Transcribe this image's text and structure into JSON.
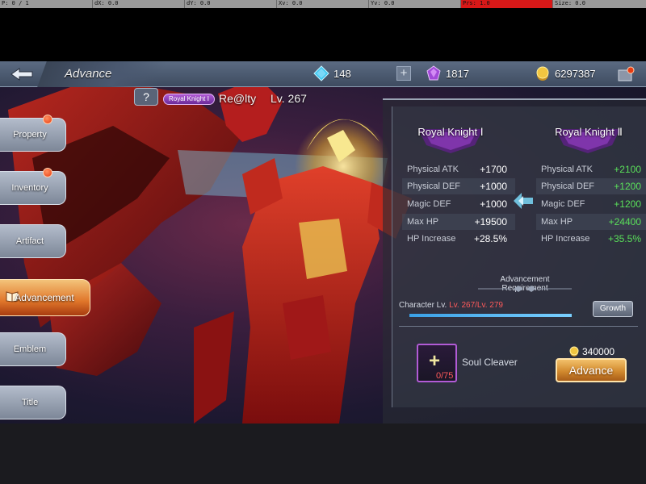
{
  "debug": {
    "p": "P: 0 / 1",
    "dx": "dX: 0.0",
    "dy": "dY: 0.0",
    "xv": "Xv: 0.0",
    "yv": "Yv: 0.0",
    "prs": "Prs: 1.0",
    "size": "Size: 0.0"
  },
  "header": {
    "title": "Advance",
    "gems": "148",
    "crystals": "1817",
    "gold": "6297387"
  },
  "nav": {
    "items": [
      {
        "label": "Property",
        "badge": true
      },
      {
        "label": "Inventory",
        "badge": true
      },
      {
        "label": "Artifact",
        "badge": false
      },
      {
        "label": "Advancement",
        "badge": false,
        "active": true
      },
      {
        "label": "Emblem",
        "badge": false
      },
      {
        "label": "Title",
        "badge": false
      }
    ]
  },
  "hero": {
    "class_badge": "Royal Knight Ⅰ",
    "name": "Re@lty",
    "level": "Lv. 267",
    "help_label": "?"
  },
  "current_rank": {
    "title": "Royal Knight Ⅰ",
    "stats": [
      {
        "label": "Physical ATK",
        "value": "+1700"
      },
      {
        "label": "Physical DEF",
        "value": "+1000"
      },
      {
        "label": "Magic DEF",
        "value": "+1000"
      },
      {
        "label": "Max HP",
        "value": "+19500"
      },
      {
        "label": "HP Increase",
        "value": "+28.5%"
      }
    ]
  },
  "next_rank": {
    "title": "Royal Knight Ⅱ",
    "stats": [
      {
        "label": "Physical ATK",
        "value": "+2100"
      },
      {
        "label": "Physical DEF",
        "value": "+1200"
      },
      {
        "label": "Magic DEF",
        "value": "+1200"
      },
      {
        "label": "Max HP",
        "value": "+24400"
      },
      {
        "label": "HP Increase",
        "value": "+35.5%"
      }
    ]
  },
  "requirement": {
    "title_line1": "Advancement",
    "title_line2": "Requirement",
    "label": "Character Lv.",
    "value": "Lv. 267/Lv. 279",
    "progress": 0.957,
    "growth_label": "Growth"
  },
  "material": {
    "name": "Soul Cleaver",
    "count": "0/75",
    "plus": "+"
  },
  "cost": {
    "gold": "340000",
    "advance_label": "Advance"
  },
  "colors": {
    "accent_gold": "#d28a2e",
    "bonus_green": "#5ae05a",
    "insufficient_red": "#ff5a5a",
    "rank_purple": "#b25bd6"
  }
}
